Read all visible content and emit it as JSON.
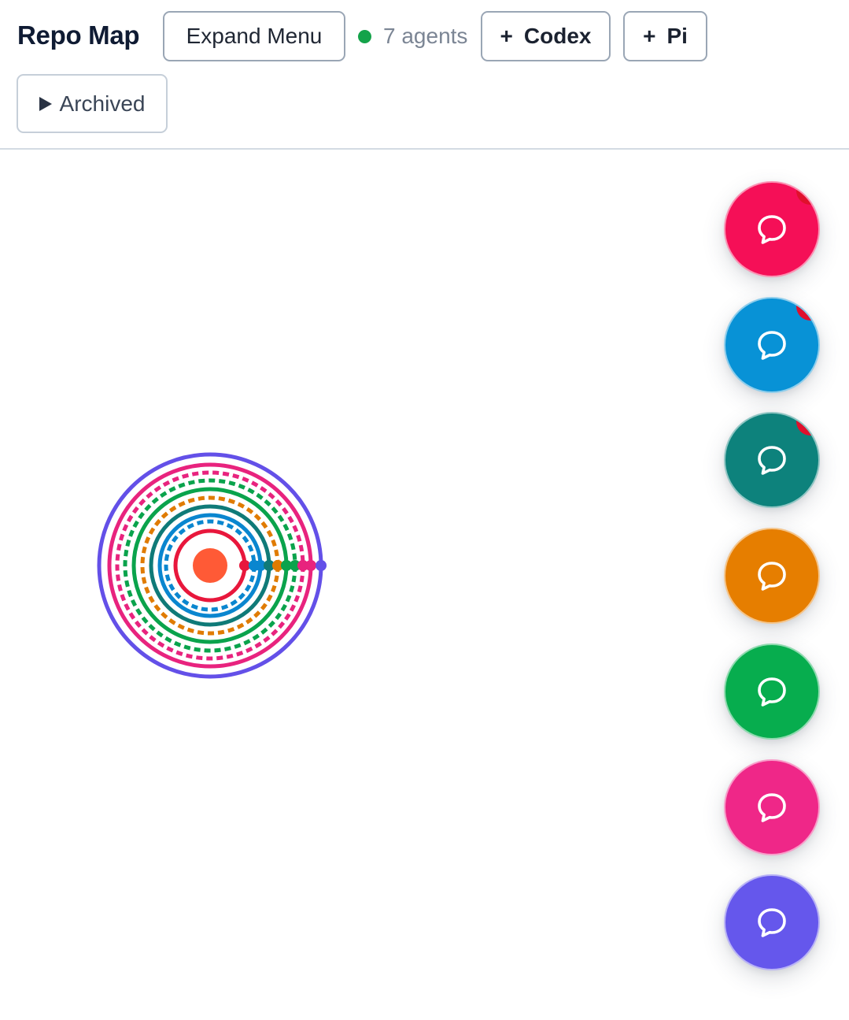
{
  "header": {
    "title": "Repo Map",
    "expand_menu_label": "Expand Menu",
    "agents_status": {
      "count_label": "7 agents",
      "dot_color": "#14a34a"
    },
    "add_codex": {
      "plus": "+",
      "label": "Codex"
    },
    "add_pi": {
      "plus": "+",
      "label": "Pi"
    },
    "archived_label": "Archived"
  },
  "repo_map": {
    "center_color": "#ff5a36",
    "rings": [
      {
        "color": "#e8173c",
        "style": "solid"
      },
      {
        "color": "#0a86cf",
        "style": "dashed"
      },
      {
        "color": "#0a86cf",
        "style": "solid"
      },
      {
        "color": "#0f7a78",
        "style": "solid"
      },
      {
        "color": "#e07b00",
        "style": "dashed"
      },
      {
        "color": "#0aa34c",
        "style": "solid"
      },
      {
        "color": "#0aa34c",
        "style": "dashed"
      },
      {
        "color": "#e8237e",
        "style": "dashed"
      },
      {
        "color": "#e8237e",
        "style": "solid"
      },
      {
        "color": "#6350e8",
        "style": "solid"
      }
    ]
  },
  "agent_buttons": [
    {
      "name": "chat-button-1",
      "icon": "chat-bubble-icon",
      "color": "#f50f57",
      "unread": true
    },
    {
      "name": "chat-button-2",
      "icon": "chat-bubble-icon",
      "color": "#0892d6",
      "unread": true
    },
    {
      "name": "chat-button-3",
      "icon": "chat-bubble-icon",
      "color": "#0d827c",
      "unread": true
    },
    {
      "name": "chat-button-4",
      "icon": "chat-bubble-icon",
      "color": "#e67e00",
      "unread": false
    },
    {
      "name": "chat-button-5",
      "icon": "chat-bubble-icon",
      "color": "#07ad4e",
      "unread": false
    },
    {
      "name": "chat-button-6",
      "icon": "chat-bubble-icon",
      "color": "#ef2788",
      "unread": false
    },
    {
      "name": "chat-button-7",
      "icon": "chat-bubble-icon",
      "color": "#6557ec",
      "unread": false
    }
  ]
}
